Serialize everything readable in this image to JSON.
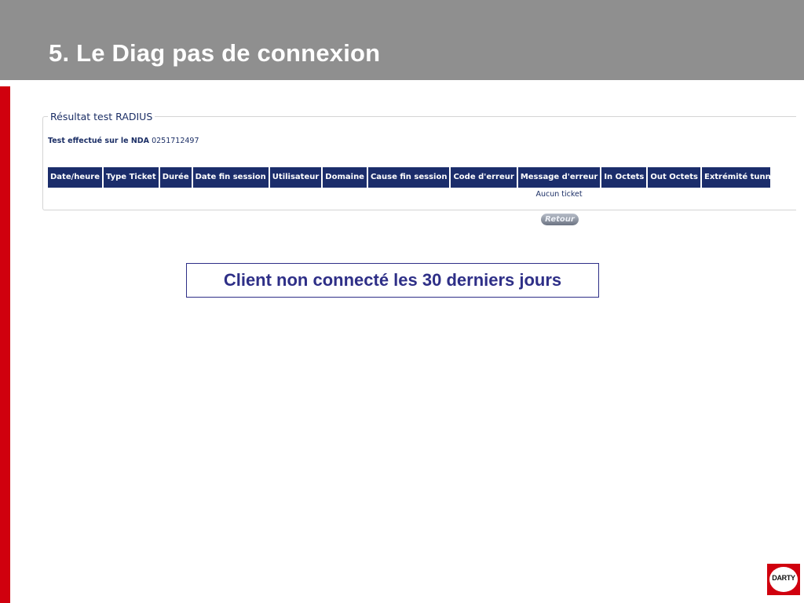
{
  "slide": {
    "title": "5. Le Diag pas de connexion",
    "callout": "Client non connecté les 30 derniers jours"
  },
  "panel": {
    "legend": "Résultat test RADIUS",
    "nda_label": "Test effectué sur le NDA",
    "nda_value": "0251712497",
    "columns": [
      "Date/heure",
      "Type Ticket",
      "Durée",
      "Date fin session",
      "Utilisateur",
      "Domaine",
      "Cause fin session",
      "Code d'erreur",
      "Message d'erreur",
      "In Octets",
      "Out Octets",
      "Extrémité tunnel L"
    ],
    "empty_message": "Aucun ticket",
    "retour_button": "Retour"
  },
  "logo": {
    "text": "DARTY"
  },
  "colors": {
    "header_bg": "#8f8f8f",
    "accent_red": "#d0000e",
    "table_header_bg": "#1b2d6b",
    "callout_text": "#2e2f87"
  }
}
